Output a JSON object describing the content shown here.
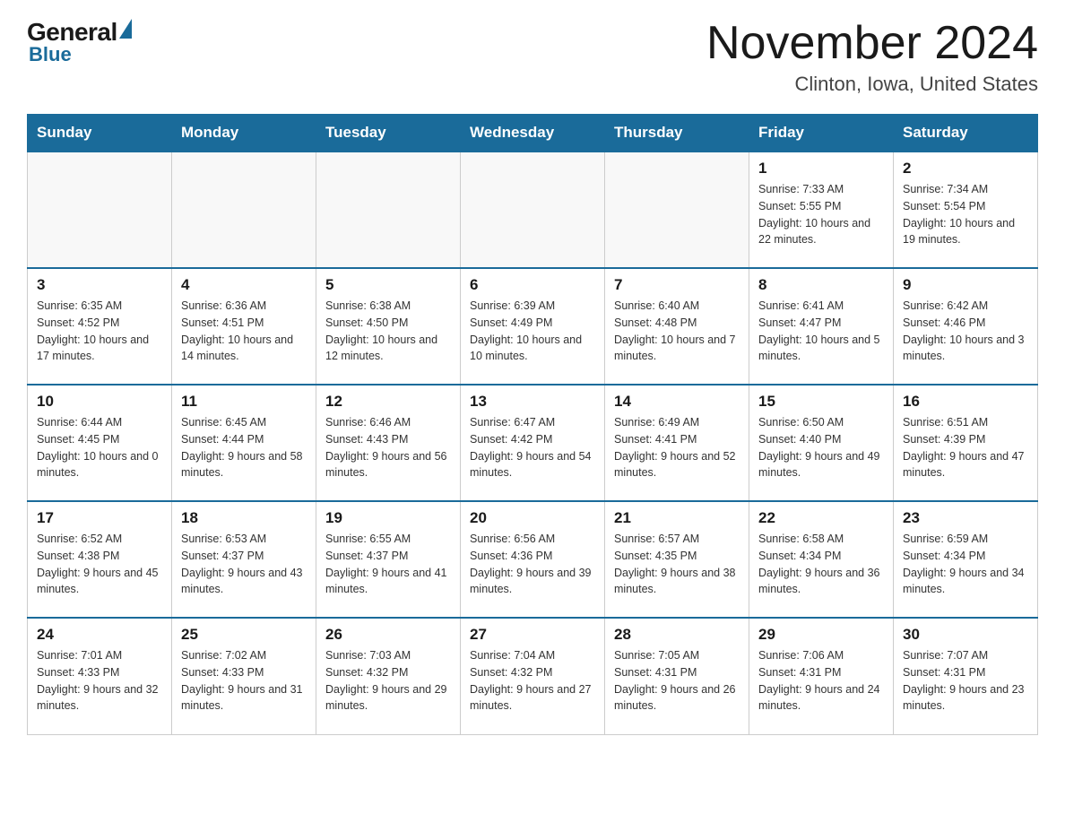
{
  "header": {
    "logo_general": "General",
    "logo_blue": "Blue",
    "month_year": "November 2024",
    "location": "Clinton, Iowa, United States"
  },
  "weekdays": [
    "Sunday",
    "Monday",
    "Tuesday",
    "Wednesday",
    "Thursday",
    "Friday",
    "Saturday"
  ],
  "weeks": [
    [
      {
        "day": "",
        "info": ""
      },
      {
        "day": "",
        "info": ""
      },
      {
        "day": "",
        "info": ""
      },
      {
        "day": "",
        "info": ""
      },
      {
        "day": "",
        "info": ""
      },
      {
        "day": "1",
        "info": "Sunrise: 7:33 AM\nSunset: 5:55 PM\nDaylight: 10 hours and 22 minutes."
      },
      {
        "day": "2",
        "info": "Sunrise: 7:34 AM\nSunset: 5:54 PM\nDaylight: 10 hours and 19 minutes."
      }
    ],
    [
      {
        "day": "3",
        "info": "Sunrise: 6:35 AM\nSunset: 4:52 PM\nDaylight: 10 hours and 17 minutes."
      },
      {
        "day": "4",
        "info": "Sunrise: 6:36 AM\nSunset: 4:51 PM\nDaylight: 10 hours and 14 minutes."
      },
      {
        "day": "5",
        "info": "Sunrise: 6:38 AM\nSunset: 4:50 PM\nDaylight: 10 hours and 12 minutes."
      },
      {
        "day": "6",
        "info": "Sunrise: 6:39 AM\nSunset: 4:49 PM\nDaylight: 10 hours and 10 minutes."
      },
      {
        "day": "7",
        "info": "Sunrise: 6:40 AM\nSunset: 4:48 PM\nDaylight: 10 hours and 7 minutes."
      },
      {
        "day": "8",
        "info": "Sunrise: 6:41 AM\nSunset: 4:47 PM\nDaylight: 10 hours and 5 minutes."
      },
      {
        "day": "9",
        "info": "Sunrise: 6:42 AM\nSunset: 4:46 PM\nDaylight: 10 hours and 3 minutes."
      }
    ],
    [
      {
        "day": "10",
        "info": "Sunrise: 6:44 AM\nSunset: 4:45 PM\nDaylight: 10 hours and 0 minutes."
      },
      {
        "day": "11",
        "info": "Sunrise: 6:45 AM\nSunset: 4:44 PM\nDaylight: 9 hours and 58 minutes."
      },
      {
        "day": "12",
        "info": "Sunrise: 6:46 AM\nSunset: 4:43 PM\nDaylight: 9 hours and 56 minutes."
      },
      {
        "day": "13",
        "info": "Sunrise: 6:47 AM\nSunset: 4:42 PM\nDaylight: 9 hours and 54 minutes."
      },
      {
        "day": "14",
        "info": "Sunrise: 6:49 AM\nSunset: 4:41 PM\nDaylight: 9 hours and 52 minutes."
      },
      {
        "day": "15",
        "info": "Sunrise: 6:50 AM\nSunset: 4:40 PM\nDaylight: 9 hours and 49 minutes."
      },
      {
        "day": "16",
        "info": "Sunrise: 6:51 AM\nSunset: 4:39 PM\nDaylight: 9 hours and 47 minutes."
      }
    ],
    [
      {
        "day": "17",
        "info": "Sunrise: 6:52 AM\nSunset: 4:38 PM\nDaylight: 9 hours and 45 minutes."
      },
      {
        "day": "18",
        "info": "Sunrise: 6:53 AM\nSunset: 4:37 PM\nDaylight: 9 hours and 43 minutes."
      },
      {
        "day": "19",
        "info": "Sunrise: 6:55 AM\nSunset: 4:37 PM\nDaylight: 9 hours and 41 minutes."
      },
      {
        "day": "20",
        "info": "Sunrise: 6:56 AM\nSunset: 4:36 PM\nDaylight: 9 hours and 39 minutes."
      },
      {
        "day": "21",
        "info": "Sunrise: 6:57 AM\nSunset: 4:35 PM\nDaylight: 9 hours and 38 minutes."
      },
      {
        "day": "22",
        "info": "Sunrise: 6:58 AM\nSunset: 4:34 PM\nDaylight: 9 hours and 36 minutes."
      },
      {
        "day": "23",
        "info": "Sunrise: 6:59 AM\nSunset: 4:34 PM\nDaylight: 9 hours and 34 minutes."
      }
    ],
    [
      {
        "day": "24",
        "info": "Sunrise: 7:01 AM\nSunset: 4:33 PM\nDaylight: 9 hours and 32 minutes."
      },
      {
        "day": "25",
        "info": "Sunrise: 7:02 AM\nSunset: 4:33 PM\nDaylight: 9 hours and 31 minutes."
      },
      {
        "day": "26",
        "info": "Sunrise: 7:03 AM\nSunset: 4:32 PM\nDaylight: 9 hours and 29 minutes."
      },
      {
        "day": "27",
        "info": "Sunrise: 7:04 AM\nSunset: 4:32 PM\nDaylight: 9 hours and 27 minutes."
      },
      {
        "day": "28",
        "info": "Sunrise: 7:05 AM\nSunset: 4:31 PM\nDaylight: 9 hours and 26 minutes."
      },
      {
        "day": "29",
        "info": "Sunrise: 7:06 AM\nSunset: 4:31 PM\nDaylight: 9 hours and 24 minutes."
      },
      {
        "day": "30",
        "info": "Sunrise: 7:07 AM\nSunset: 4:31 PM\nDaylight: 9 hours and 23 minutes."
      }
    ]
  ]
}
